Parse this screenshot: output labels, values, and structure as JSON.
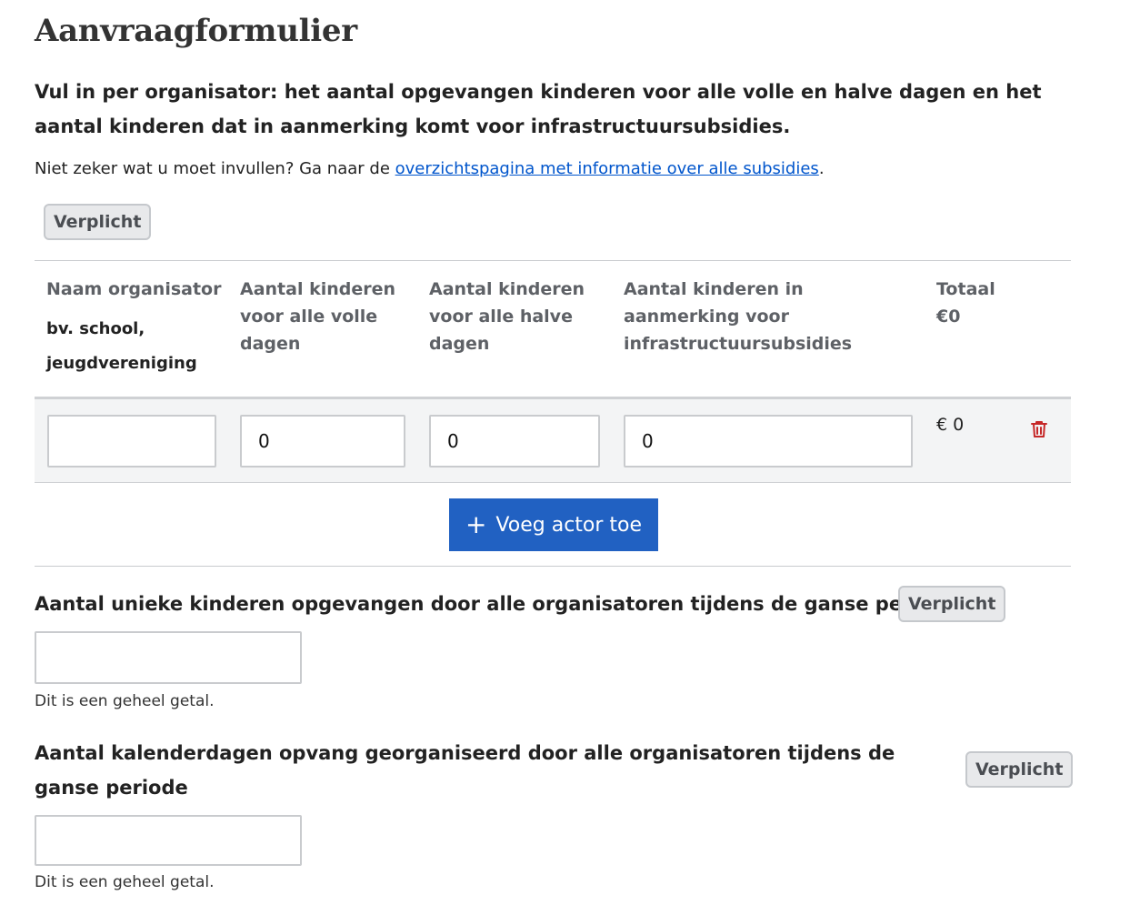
{
  "title": "Aanvraagformulier",
  "intro": "Vul in per organisator: het aantal opgevangen kinderen voor alle volle en halve dagen en het aantal kinderen dat in aanmerking komt voor infrastructuursubsidies.",
  "hint": {
    "prefix": "Niet zeker wat u moet invullen? Ga naar de ",
    "link_text": "overzichtspagina met informatie over alle subsidies",
    "suffix": "."
  },
  "required_label": "Verplicht",
  "table": {
    "headers": {
      "name": "Naam organisator",
      "name_example": "bv. school, jeugdvereniging",
      "full_days": "Aantal kinderen voor alle volle dagen",
      "half_days": "Aantal kinderen voor alle halve dagen",
      "infra": "Aantal kinderen in aanmerking voor infrastructuursubsidies",
      "total": "Totaal €0"
    },
    "rows": [
      {
        "name": "",
        "full_days": "0",
        "half_days": "0",
        "infra": "0",
        "total": "€ 0",
        "delete_icon": "trash-icon"
      }
    ]
  },
  "add_button": {
    "icon": "plus-icon",
    "label": "Voeg actor toe"
  },
  "fields": {
    "unique_children": {
      "label": "Aantal unieke kinderen opgevangen door alle organisatoren tijdens de ganse periode",
      "value": "",
      "help": "Dit is een geheel getal."
    },
    "calendar_days": {
      "label": "Aantal kalenderdagen opvang georganiseerd door alle organisatoren tijdens de ganse periode",
      "value": "",
      "help": "Dit is een geheel getal."
    }
  },
  "colors": {
    "primary_button": "#2161c2",
    "link": "#0055cc",
    "delete_icon": "#c62828",
    "badge_bg": "#e8e9eb"
  }
}
